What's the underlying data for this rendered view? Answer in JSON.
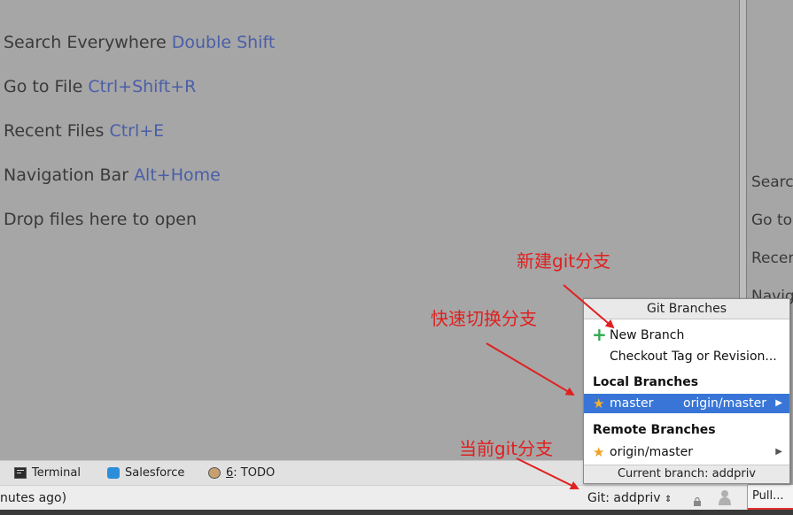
{
  "editor": {
    "hints": [
      {
        "text": "Search Everywhere",
        "key": "Double Shift"
      },
      {
        "text": "Go to File",
        "key": "Ctrl+Shift+R"
      },
      {
        "text": "Recent Files",
        "key": "Ctrl+E"
      },
      {
        "text": "Navigation Bar",
        "key": "Alt+Home"
      },
      {
        "text": "Drop files here to open",
        "key": ""
      }
    ]
  },
  "right_pane": {
    "hints": [
      "Search",
      "Go to",
      "Recen",
      "Navig"
    ]
  },
  "tool_windows": {
    "terminal": "Terminal",
    "salesforce": "Salesforce",
    "todo_num": "6",
    "todo": ": TODO"
  },
  "status_bar": {
    "message": "nutes ago)",
    "git_branch": "Git: addpriv",
    "pull": "Pull..."
  },
  "git_popup": {
    "title": "Git Branches",
    "new_branch": "New Branch",
    "checkout_tag": "Checkout Tag or Revision...",
    "local_section": "Local Branches",
    "local_branch": "master",
    "local_tracking": "origin/master",
    "remote_section": "Remote Branches",
    "remote_branch": "origin/master",
    "current_branch": "Current branch: addpriv"
  },
  "annotations": {
    "new_branch": "新建git分支",
    "switch_branch": "快速切换分支",
    "current_branch": "当前git分支"
  },
  "colors": {
    "annotation": "#e02020",
    "selection": "#3875d7",
    "shortcut": "#4a5ea8"
  }
}
